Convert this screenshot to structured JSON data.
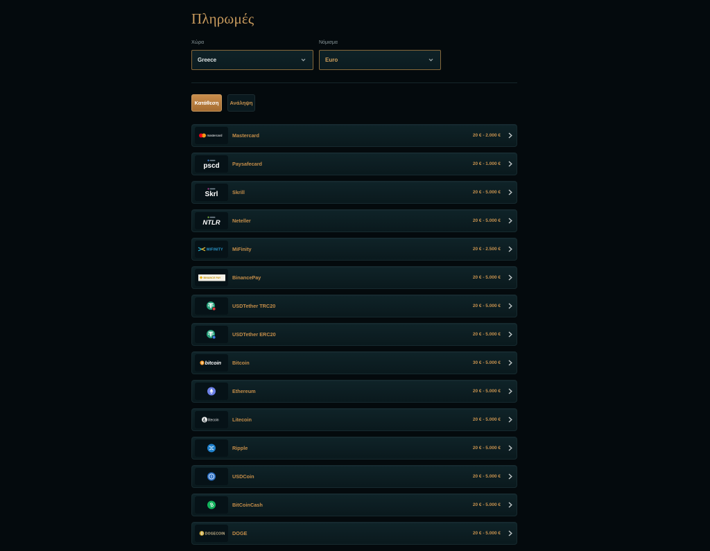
{
  "page": {
    "title": "Πληρωμές"
  },
  "filters": {
    "country": {
      "label": "Χώρα",
      "value": "Greece",
      "icon": "chevron-down-icon"
    },
    "currency": {
      "label": "Νόμισμα",
      "value": "Euro",
      "icon": "chevron-down-icon"
    }
  },
  "tabs": [
    {
      "label": "Κατάθεση",
      "active": true
    },
    {
      "label": "Ανάληψη",
      "active": false
    }
  ],
  "methods": [
    {
      "name": "Mastercard",
      "range": "20 € - 2.000 €",
      "icon": "mastercard-logo",
      "logo_text": "mastercard"
    },
    {
      "name": "Paysafecard",
      "range": "20 € - 1.000 €",
      "icon": "paysafecard-logo",
      "logo_text": "pscd"
    },
    {
      "name": "Skrill",
      "range": "20 € - 5.000 €",
      "icon": "skrill-logo",
      "logo_text": "Skrl"
    },
    {
      "name": "Neteller",
      "range": "20 € - 5.000 €",
      "icon": "neteller-logo",
      "logo_text": "NTLR"
    },
    {
      "name": "MiFinity",
      "range": "20 € - 2.500 €",
      "icon": "mifinity-logo",
      "logo_text": "MIFINITY"
    },
    {
      "name": "BinancePay",
      "range": "20 € - 5.000 €",
      "icon": "binance-pay-logo",
      "logo_text": "BINANCE PAY"
    },
    {
      "name": "USDTether TRC20",
      "range": "20 € - 5.000 €",
      "icon": "tether-trc20-icon"
    },
    {
      "name": "USDTether ERC20",
      "range": "20 € - 5.000 €",
      "icon": "tether-erc20-icon"
    },
    {
      "name": "Bitcoin",
      "range": "30 € - 5.000 €",
      "icon": "bitcoin-logo",
      "logo_text": "bitcoin"
    },
    {
      "name": "Ethereum",
      "range": "20 € - 5.000 €",
      "icon": "ethereum-icon"
    },
    {
      "name": "Litecoin",
      "range": "20 € - 5.000 €",
      "icon": "litecoin-logo",
      "logo_text": "litecoin"
    },
    {
      "name": "Ripple",
      "range": "20 € - 5.000 €",
      "icon": "ripple-icon"
    },
    {
      "name": "USDCoin",
      "range": "20 € - 5.000 €",
      "icon": "usdcoin-icon"
    },
    {
      "name": "BitCoinCash",
      "range": "20 € - 5.000 €",
      "icon": "bitcoin-cash-icon"
    },
    {
      "name": "DOGE",
      "range": "20 € - 5.000 €",
      "icon": "dogecoin-logo",
      "logo_text": "DOGECOIN"
    }
  ],
  "colors": {
    "background": "#040a0d",
    "accent_gold": "#c48d49",
    "select_border": "#87683a",
    "tab_active": "#b97c3e",
    "row_background": "#0d1f24"
  }
}
